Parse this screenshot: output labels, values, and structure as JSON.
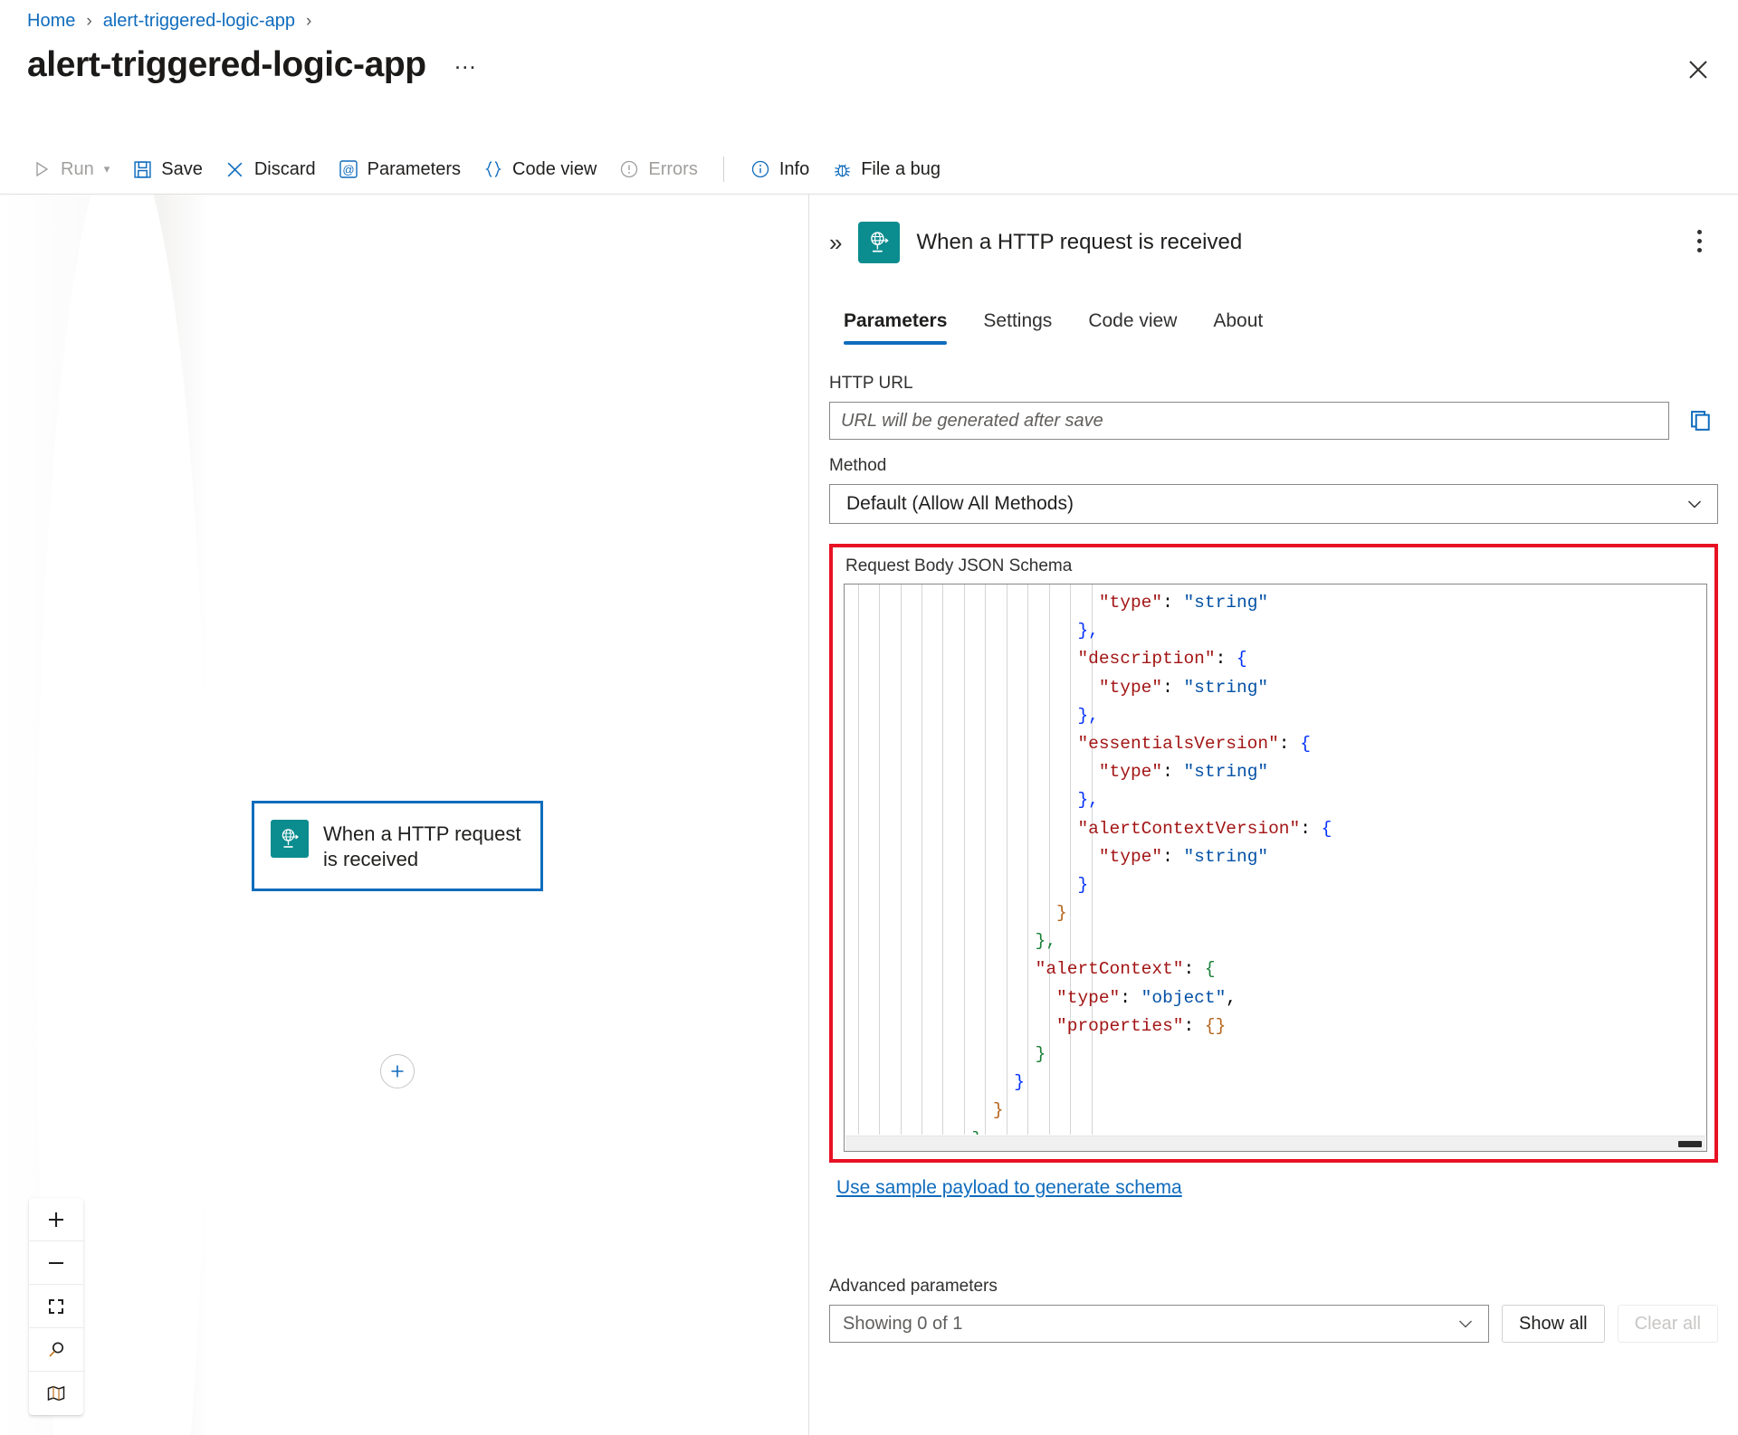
{
  "breadcrumb": {
    "items": [
      "Home",
      "alert-triggered-logic-app"
    ],
    "separator": "›"
  },
  "header": {
    "title": "alert-triggered-logic-app",
    "ellipsis": "…",
    "close_label": "Close"
  },
  "toolbar": {
    "run": "Run",
    "save": "Save",
    "discard": "Discard",
    "parameters": "Parameters",
    "code_view": "Code view",
    "errors": "Errors",
    "info": "Info",
    "file_a_bug": "File a bug"
  },
  "canvas": {
    "node_title": "When a HTTP request\nis received",
    "add_button": "+",
    "zoom_in": "+",
    "zoom_out": "−"
  },
  "panel": {
    "title": "When a HTTP request is received",
    "collapse": "»",
    "tabs": [
      {
        "label": "Parameters",
        "active": true
      },
      {
        "label": "Settings",
        "active": false
      },
      {
        "label": "Code view",
        "active": false
      },
      {
        "label": "About",
        "active": false
      }
    ],
    "http_url": {
      "label": "HTTP URL",
      "value": "URL will be generated after save"
    },
    "method": {
      "label": "Method",
      "value": "Default (Allow All Methods)"
    },
    "schema": {
      "label": "Request Body JSON Schema",
      "highlight_color": "#e81123",
      "sample_link": "Use sample payload to generate schema"
    },
    "advanced": {
      "label": "Advanced parameters",
      "value": "Showing 0 of 1",
      "show_all": "Show all",
      "clear_all": "Clear all"
    }
  },
  "code": {
    "lines": [
      {
        "indent": 24,
        "parts": [
          {
            "t": "\"type\"",
            "c": "key"
          },
          {
            "t": ": ",
            "c": "plain"
          },
          {
            "t": "\"string\"",
            "c": "str"
          }
        ]
      },
      {
        "indent": 22,
        "parts": [
          {
            "t": "},",
            "c": "p-blue"
          }
        ]
      },
      {
        "indent": 22,
        "parts": [
          {
            "t": "\"description\"",
            "c": "key"
          },
          {
            "t": ": ",
            "c": "plain"
          },
          {
            "t": "{",
            "c": "p-blue"
          }
        ]
      },
      {
        "indent": 24,
        "parts": [
          {
            "t": "\"type\"",
            "c": "key"
          },
          {
            "t": ": ",
            "c": "plain"
          },
          {
            "t": "\"string\"",
            "c": "str"
          }
        ]
      },
      {
        "indent": 22,
        "parts": [
          {
            "t": "},",
            "c": "p-blue"
          }
        ]
      },
      {
        "indent": 22,
        "parts": [
          {
            "t": "\"essentialsVersion\"",
            "c": "key"
          },
          {
            "t": ": ",
            "c": "plain"
          },
          {
            "t": "{",
            "c": "p-blue"
          }
        ]
      },
      {
        "indent": 24,
        "parts": [
          {
            "t": "\"type\"",
            "c": "key"
          },
          {
            "t": ": ",
            "c": "plain"
          },
          {
            "t": "\"string\"",
            "c": "str"
          }
        ]
      },
      {
        "indent": 22,
        "parts": [
          {
            "t": "},",
            "c": "p-blue"
          }
        ]
      },
      {
        "indent": 22,
        "parts": [
          {
            "t": "\"alertContextVersion\"",
            "c": "key"
          },
          {
            "t": ": ",
            "c": "plain"
          },
          {
            "t": "{",
            "c": "p-blue"
          }
        ]
      },
      {
        "indent": 24,
        "parts": [
          {
            "t": "\"type\"",
            "c": "key"
          },
          {
            "t": ": ",
            "c": "plain"
          },
          {
            "t": "\"string\"",
            "c": "str"
          }
        ]
      },
      {
        "indent": 22,
        "parts": [
          {
            "t": "}",
            "c": "p-blue"
          }
        ]
      },
      {
        "indent": 20,
        "parts": [
          {
            "t": "}",
            "c": "p-orange"
          }
        ]
      },
      {
        "indent": 18,
        "parts": [
          {
            "t": "},",
            "c": "p-green"
          }
        ]
      },
      {
        "indent": 18,
        "parts": [
          {
            "t": "\"alertContext\"",
            "c": "key"
          },
          {
            "t": ": ",
            "c": "plain"
          },
          {
            "t": "{",
            "c": "p-green"
          }
        ]
      },
      {
        "indent": 20,
        "parts": [
          {
            "t": "\"type\"",
            "c": "key"
          },
          {
            "t": ": ",
            "c": "plain"
          },
          {
            "t": "\"object\"",
            "c": "str"
          },
          {
            "t": ",",
            "c": "plain"
          }
        ]
      },
      {
        "indent": 20,
        "parts": [
          {
            "t": "\"properties\"",
            "c": "key"
          },
          {
            "t": ": ",
            "c": "plain"
          },
          {
            "t": "{}",
            "c": "p-orange"
          }
        ]
      },
      {
        "indent": 18,
        "parts": [
          {
            "t": "}",
            "c": "p-green"
          }
        ]
      },
      {
        "indent": 16,
        "parts": [
          {
            "t": "}",
            "c": "p-blue"
          }
        ]
      },
      {
        "indent": 14,
        "parts": [
          {
            "t": "}",
            "c": "p-orange"
          }
        ]
      },
      {
        "indent": 12,
        "parts": [
          {
            "t": "}",
            "c": "p-green"
          }
        ]
      },
      {
        "indent": 10,
        "parts": [
          {
            "t": "}",
            "c": "p-blue"
          }
        ]
      }
    ],
    "guide_columns": [
      1,
      3,
      5,
      7,
      9,
      11,
      13,
      15,
      17,
      19,
      21,
      23
    ]
  }
}
